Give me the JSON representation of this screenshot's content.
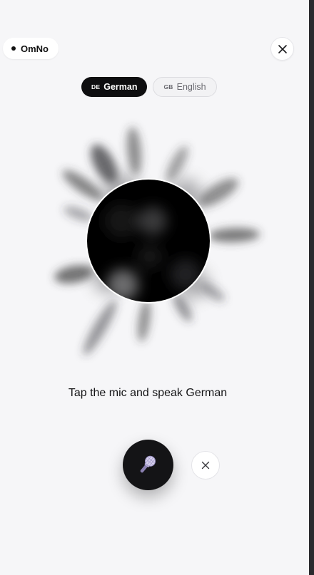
{
  "brand": {
    "name": "OmNo"
  },
  "header": {
    "close_icon": "close-icon"
  },
  "languages": [
    {
      "code": "DE",
      "label": "German",
      "active": true
    },
    {
      "code": "GB",
      "label": "English",
      "active": false
    }
  ],
  "main": {
    "prompt": "Tap the mic and speak German"
  },
  "controls": {
    "mic_icon": "microphone-icon",
    "cancel_icon": "close-icon"
  },
  "colors": {
    "background": "#f6f6f8",
    "accent": "#0e0e10",
    "orb": "#000000"
  }
}
